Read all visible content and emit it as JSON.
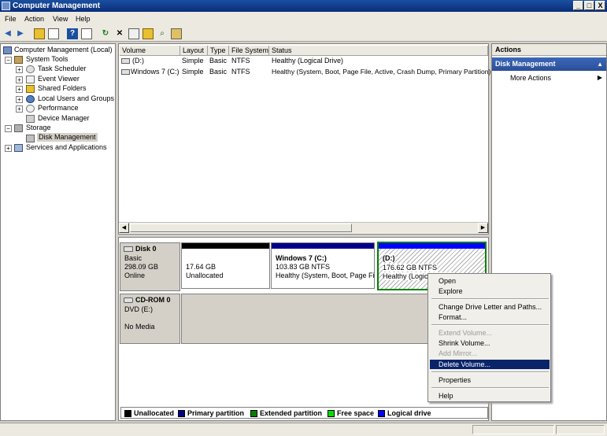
{
  "window": {
    "title": "Computer Management",
    "min": "_",
    "max": "□",
    "close": "X"
  },
  "menubar": {
    "items": [
      "File",
      "Action",
      "View",
      "Help"
    ]
  },
  "toolbar": {
    "icons": [
      "back-arrow-icon",
      "forward-arrow-icon",
      "up-folder-icon",
      "show-hide-tree-icon",
      "help-icon",
      "properties-pane-icon",
      "refresh-icon",
      "delete-icon",
      "properties-icon",
      "open-icon",
      "search-icon",
      "disk-icon"
    ]
  },
  "tree": {
    "root": "Computer Management (Local)",
    "system_tools": "System Tools",
    "task_scheduler": "Task Scheduler",
    "event_viewer": "Event Viewer",
    "shared_folders": "Shared Folders",
    "local_users": "Local Users and Groups",
    "performance": "Performance",
    "device_manager": "Device Manager",
    "storage": "Storage",
    "disk_management": "Disk Management",
    "services": "Services and Applications",
    "exp_plus": "+",
    "exp_minus": "−"
  },
  "volumes": {
    "headers": [
      "Volume",
      "Layout",
      "Type",
      "File System",
      "Status"
    ],
    "rows": [
      {
        "volume": "(D:)",
        "layout": "Simple",
        "type": "Basic",
        "fs": "NTFS",
        "status": "Healthy (Logical Drive)"
      },
      {
        "volume": "Windows 7 (C:)",
        "layout": "Simple",
        "type": "Basic",
        "fs": "NTFS",
        "status": "Healthy (System, Boot, Page File, Active, Crash Dump, Primary Partition)"
      }
    ]
  },
  "scroll": {
    "left": "◀",
    "right": "▶"
  },
  "disks": {
    "disk0": {
      "name": "Disk 0",
      "type": "Basic",
      "size": "298.09 GB",
      "state": "Online"
    },
    "p_unalloc": {
      "size": "17.64 GB",
      "label": "Unallocated"
    },
    "p_c": {
      "name": "Windows 7  (C:)",
      "size": "103.83 GB NTFS",
      "status": "Healthy (System, Boot, Page File"
    },
    "p_d": {
      "name": "(D:)",
      "size": "176.62 GB NTFS",
      "status": "Healthy (Logical Drive)"
    },
    "cdrom": {
      "name": "CD-ROM 0",
      "drive": "DVD (E:)",
      "media": "No Media"
    }
  },
  "legend": {
    "unallocated": "Unallocated",
    "primary": "Primary partition",
    "extended": "Extended partition",
    "free": "Free space",
    "logical": "Logical drive",
    "colors": {
      "unallocated": "#000000",
      "primary": "#00008b",
      "extended": "#008000",
      "free": "#00e000",
      "logical": "#0000ff"
    }
  },
  "actions": {
    "header": "Actions",
    "section": "Disk Management",
    "more": "More Actions",
    "collapse": "▲",
    "more_arrow": "▶"
  },
  "context_menu": {
    "items": [
      "Open",
      "Explore",
      "Change Drive Letter and Paths...",
      "Format...",
      "Extend Volume...",
      "Shrink Volume...",
      "Add Mirror...",
      "Delete Volume...",
      "Properties",
      "Help"
    ]
  }
}
